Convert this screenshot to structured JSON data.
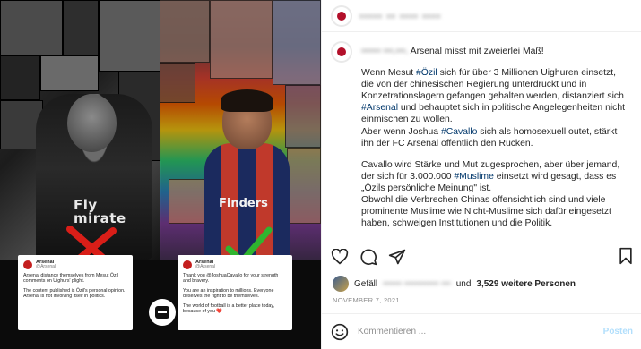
{
  "media": {
    "left_kit_text": "Fly\nmirate",
    "right_kit_text": "Finders",
    "card_left": {
      "name": "Arsenal",
      "handle": "@Arsenal",
      "text1": "Arsenal distance themselves from Mesut Özil comments on Uighurs' plight.",
      "text2": "The content published is Özil's personal opinion. Arsenal is not involving itself in politics."
    },
    "card_right": {
      "name": "Arsenal",
      "handle": "@Arsenal",
      "text1": "Thank you @JoshuaCavallo for your strength and bravery.",
      "text2": "You are an inspiration to millions. Everyone deserves the right to be themselves.",
      "text3": "The world of football is a better place today, because of you ❤️"
    }
  },
  "post": {
    "header_username": "••••• •• •••• ••••",
    "caption": {
      "username": "•••••• •••.•••.",
      "headline": "Arsenal misst mit zweierlei Maß!",
      "p1_a": "Wenn Mesut ",
      "p1_tag1": "#Özil",
      "p1_b": " sich für über 3 Millionen Uighuren einsetzt, die von der chinesischen Regierung unterdrückt und in Konzetrationslagern gefangen gehalten werden, distanziert sich ",
      "p1_tag2": "#Arsenal",
      "p1_c": " und behauptet sich in politische Angelegenheiten nicht einmischen zu wollen.",
      "p2_a": "Aber wenn Joshua ",
      "p2_tag": "#Cavallo",
      "p2_b": " sich als homosexuell outet, stärkt ihn der FC Arsenal öffentlich den Rücken.",
      "p3_a": "Cavallo wird Stärke und Mut zugesprochen, aber über jemand, der sich für 3.000.000 ",
      "p3_tag": "#Muslime",
      "p3_b": " einsetzt wird gesagt, dass es „Özils persönliche Meinung\" ist.",
      "p4": "Obwohl die Verbrechen Chinas offensichtlich sind und viele prominente Muslime wie Nicht-Muslime sich dafür eingesetzt haben, schweigen Institutionen und die Politik."
    },
    "likes": {
      "prefix": "Gefäll",
      "liker": "•••••• ••••••••••• •••",
      "middle": " und ",
      "count": "3,529 weitere Personen"
    },
    "date": "NOVEMBER 7, 2021",
    "comment_placeholder": "Kommentieren ...",
    "post_button": "Posten",
    "colors": {
      "hashtag": "#00376b",
      "muted": "#8e8e8e",
      "post_button": "#b2dffc",
      "red_x": "#d91e18",
      "green_check": "#2fb52f"
    }
  }
}
